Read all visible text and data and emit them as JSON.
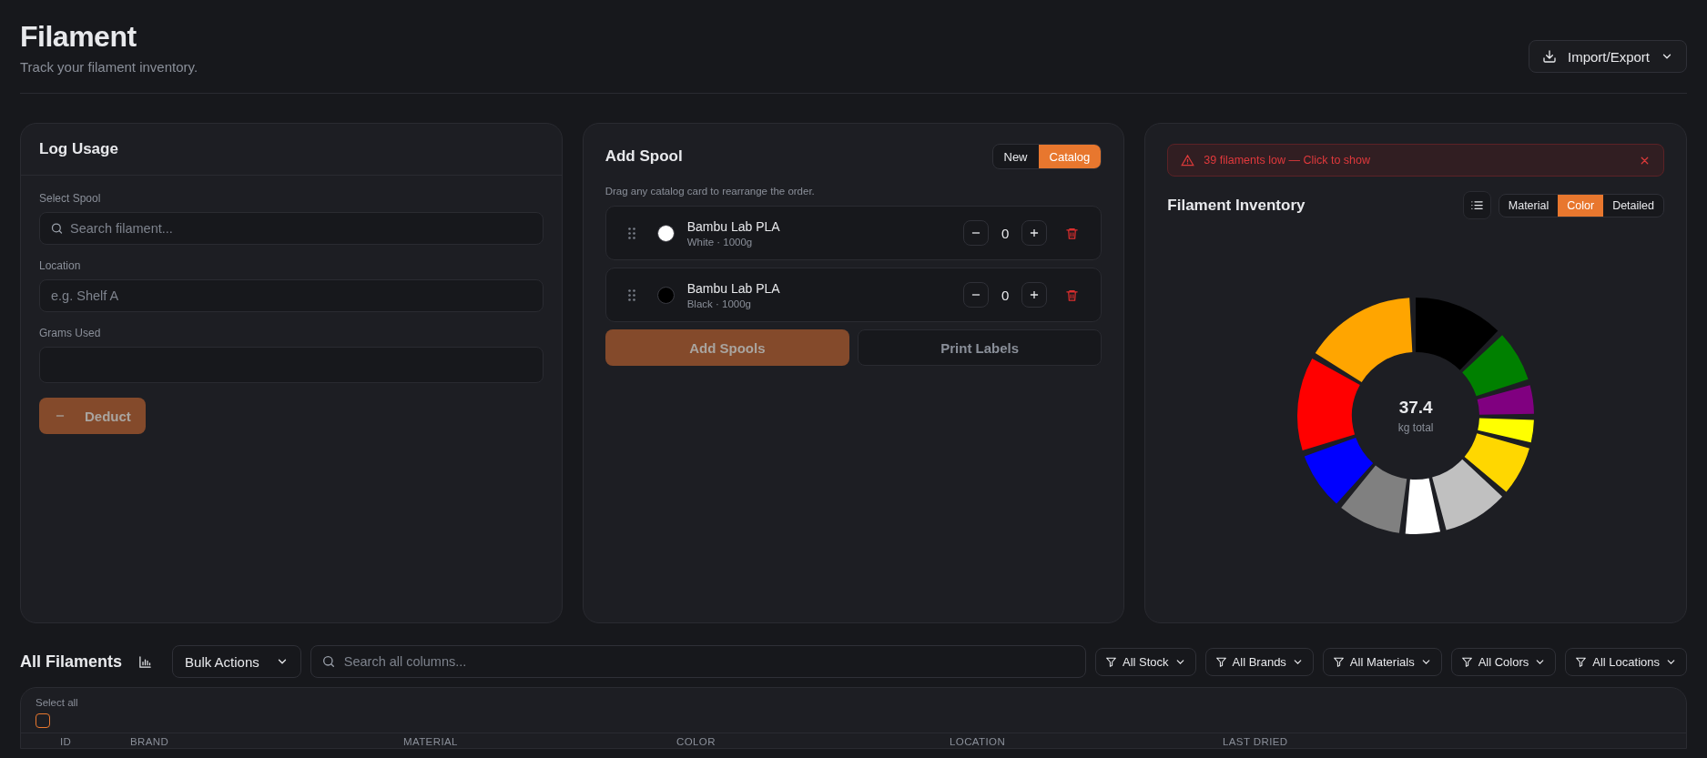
{
  "header": {
    "title": "Filament",
    "subtitle": "Track your filament inventory."
  },
  "import_export_button": {
    "label": "Import/Export"
  },
  "log_usage": {
    "title": "Log Usage",
    "fields": [
      {
        "label": "Select Spool",
        "placeholder": "Search filament...",
        "kind": "search"
      },
      {
        "label": "Location",
        "placeholder": "e.g. Shelf A",
        "kind": "text"
      },
      {
        "label": "Grams Used",
        "kind": "number"
      }
    ],
    "button": {
      "label": "Deduct",
      "disabled": true
    }
  },
  "add_spool": {
    "title": "Add Spool",
    "modes": [
      {
        "label": "New",
        "selected": false
      },
      {
        "label": "Catalog",
        "selected": true
      }
    ],
    "hint": "Drag any catalog card to rearrange the order.",
    "spools": [
      {
        "name": "Bambu Lab PLA",
        "details": "White · 1000g",
        "color": "#ffffff",
        "quantity": "0"
      },
      {
        "name": "Bambu Lab PLA",
        "details": "Black · 1000g",
        "color": "#000000",
        "quantity": "0"
      }
    ],
    "buttons": [
      {
        "label": "Add Spools",
        "kind": "primary",
        "disabled": true
      },
      {
        "label": "Print Labels",
        "kind": "secondary",
        "disabled": true
      }
    ]
  },
  "inventory": {
    "alert": "39 filaments low — Click to show",
    "title": "Filament Inventory",
    "views": [
      {
        "label": "Material",
        "selected": false
      },
      {
        "label": "Color",
        "selected": true
      },
      {
        "label": "Detailed",
        "selected": false
      }
    ],
    "total": "37.4",
    "total_unit": "kg total"
  },
  "all_filaments": {
    "title": "All Filaments",
    "bulk_actions": "Bulk Actions",
    "search_placeholder": "Search all columns...",
    "filters": [
      "All Stock",
      "All Brands",
      "All Materials",
      "All Colors",
      "All Locations"
    ],
    "select_all": {
      "label": "Select all",
      "checked": false
    },
    "columns": [
      "ID",
      "BRAND",
      "MATERIAL",
      "COLOR",
      "LOCATION",
      "LAST DRIED"
    ]
  }
}
